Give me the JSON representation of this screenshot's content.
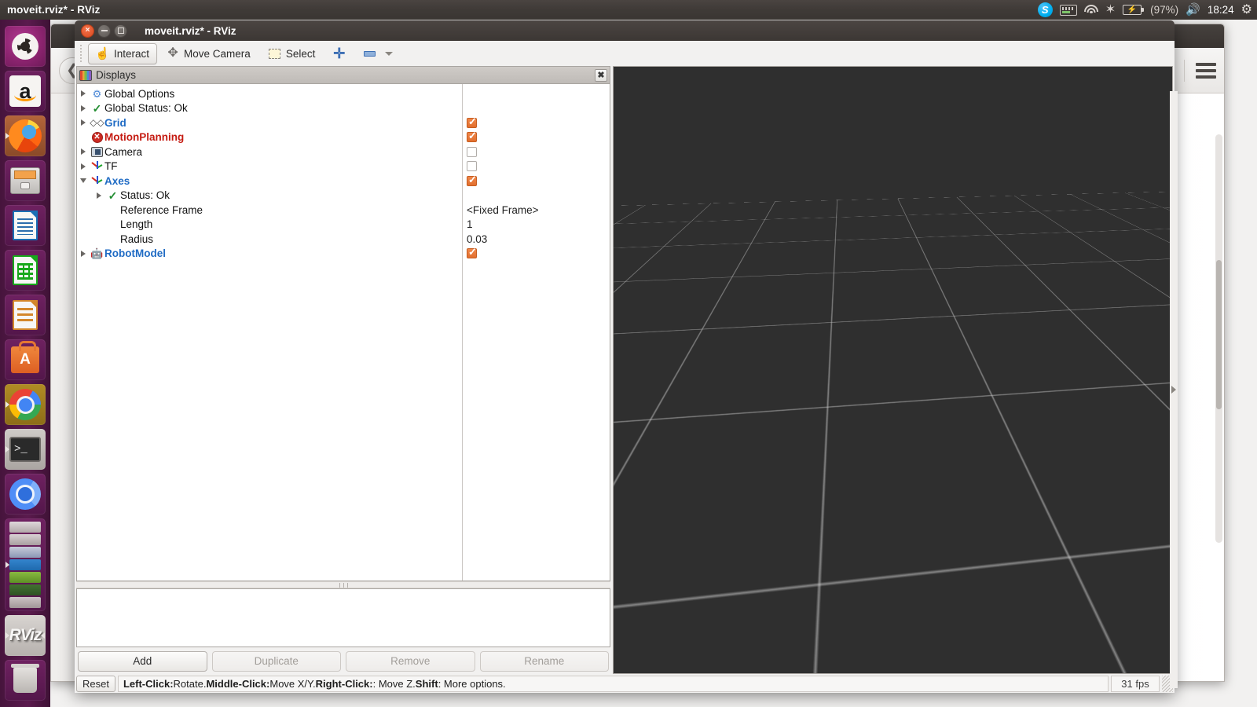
{
  "desktop": {
    "panel_title": "moveit.rviz* - RViz",
    "tray": [
      {
        "name": "skype-icon",
        "label": "S"
      },
      {
        "name": "keyboard-indicator-icon",
        "label": ""
      },
      {
        "name": "wifi-icon",
        "label": ""
      },
      {
        "name": "bluetooth-icon",
        "label": "✶"
      },
      {
        "name": "battery-icon",
        "label": ""
      },
      {
        "name": "volume-icon",
        "label": "🔊"
      },
      {
        "name": "power-gear-icon",
        "label": "⚙"
      }
    ],
    "battery_percent": "(97%)",
    "clock": "18:24"
  },
  "launcher": {
    "items": [
      {
        "name": "ubuntu-dash",
        "label": "Ubuntu"
      },
      {
        "name": "amazon",
        "label": "a"
      },
      {
        "name": "firefox",
        "label": "Firefox"
      },
      {
        "name": "files",
        "label": "Files"
      },
      {
        "name": "libreoffice-writer",
        "label": "Writer"
      },
      {
        "name": "libreoffice-calc",
        "label": "Calc"
      },
      {
        "name": "libreoffice-impress",
        "label": "Impress"
      },
      {
        "name": "ubuntu-software",
        "label": "A"
      },
      {
        "name": "google-chrome",
        "label": "Chrome"
      },
      {
        "name": "terminal",
        "label": "> _"
      },
      {
        "name": "chromium",
        "label": "Chromium"
      },
      {
        "name": "device-stack",
        "label": "Devices"
      },
      {
        "name": "rviz",
        "label": "RViz"
      },
      {
        "name": "trash",
        "label": "Trash"
      }
    ],
    "rviz_label": "RViz"
  },
  "rviz": {
    "title": "moveit.rviz* - RViz",
    "window_buttons": {
      "close": "×",
      "minimize": "–",
      "maximize": "□"
    },
    "toolbar": [
      {
        "name": "interact",
        "label": "Interact",
        "icon": "hand-icon",
        "active": true
      },
      {
        "name": "move-camera",
        "label": "Move Camera",
        "icon": "move-camera-icon",
        "active": false
      },
      {
        "name": "select",
        "label": "Select",
        "icon": "select-rect-icon",
        "active": false
      },
      {
        "name": "add-tool",
        "label": "",
        "icon": "plus-icon",
        "active": false
      },
      {
        "name": "remove-tool",
        "label": "",
        "icon": "minus-icon",
        "active": false
      }
    ],
    "displays_panel": {
      "header": "Displays",
      "close_label": "✖",
      "tree": [
        {
          "label": "Global Options",
          "icon": "gear-icon",
          "style": "normal",
          "twisty": "closed",
          "indent": 0,
          "value": "",
          "value_type": "none"
        },
        {
          "label": "Global Status: Ok",
          "icon": "check-icon",
          "style": "normal",
          "twisty": "closed",
          "indent": 0,
          "value": "",
          "value_type": "none"
        },
        {
          "label": "Grid",
          "icon": "grid-icon",
          "style": "blue",
          "twisty": "closed",
          "indent": 0,
          "value": "",
          "value_type": "checkbox-on"
        },
        {
          "label": "MotionPlanning",
          "icon": "error-icon",
          "style": "red",
          "twisty": "none",
          "indent": 0,
          "value": "",
          "value_type": "checkbox-on"
        },
        {
          "label": "Camera",
          "icon": "camera-icon",
          "style": "normal",
          "twisty": "closed",
          "indent": 0,
          "value": "",
          "value_type": "checkbox-off"
        },
        {
          "label": "TF",
          "icon": "axes-icon",
          "style": "normal",
          "twisty": "closed",
          "indent": 0,
          "value": "",
          "value_type": "checkbox-off"
        },
        {
          "label": "Axes",
          "icon": "axes-icon",
          "style": "blue",
          "twisty": "open",
          "indent": 0,
          "value": "",
          "value_type": "checkbox-on"
        },
        {
          "label": "Status: Ok",
          "icon": "check-icon",
          "style": "normal",
          "twisty": "closed",
          "indent": 1,
          "value": "",
          "value_type": "none"
        },
        {
          "label": "Reference Frame",
          "icon": "none",
          "style": "normal",
          "twisty": "none",
          "indent": 1,
          "value": "<Fixed Frame>",
          "value_type": "text"
        },
        {
          "label": "Length",
          "icon": "none",
          "style": "normal",
          "twisty": "none",
          "indent": 1,
          "value": "1",
          "value_type": "text"
        },
        {
          "label": "Radius",
          "icon": "none",
          "style": "normal",
          "twisty": "none",
          "indent": 1,
          "value": "0.03",
          "value_type": "text"
        },
        {
          "label": "RobotModel",
          "icon": "robot-icon",
          "style": "blue",
          "twisty": "closed",
          "indent": 0,
          "value": "",
          "value_type": "checkbox-on"
        }
      ]
    },
    "buttons": [
      {
        "name": "add-button",
        "label": "Add",
        "disabled": false
      },
      {
        "name": "duplicate-button",
        "label": "Duplicate",
        "disabled": true
      },
      {
        "name": "remove-button",
        "label": "Remove",
        "disabled": true
      },
      {
        "name": "rename-button",
        "label": "Rename",
        "disabled": true
      }
    ],
    "status_bar": {
      "reset_label": "Reset",
      "hint_parts": [
        {
          "text": "Left-Click:",
          "bold": true
        },
        {
          "text": " Rotate. ",
          "bold": false
        },
        {
          "text": "Middle-Click:",
          "bold": true
        },
        {
          "text": " Move X/Y. ",
          "bold": false
        },
        {
          "text": "Right-Click:",
          "bold": true
        },
        {
          "text": ": Move Z. ",
          "bold": false
        },
        {
          "text": "Shift",
          "bold": true
        },
        {
          "text": ": More options.",
          "bold": false
        }
      ],
      "fps": "31 fps"
    },
    "viewport": {
      "background_color": "#2f2f2f",
      "grid_color": "#cdcdcd",
      "axis_x_color": "#ff2d1a",
      "axis_y_color": "#2bff27",
      "axis_z_color": "#2a4fd4"
    }
  }
}
